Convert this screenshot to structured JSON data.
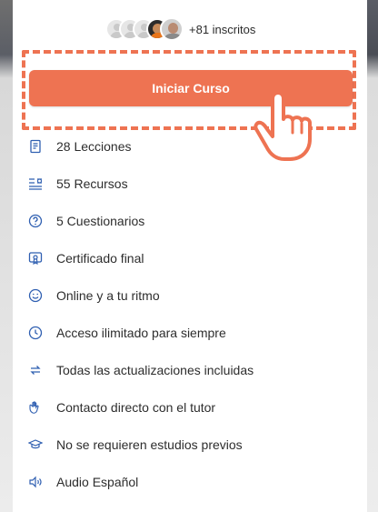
{
  "course_card": {
    "enrolled_text": "+81 inscritos",
    "cta_label": "Iniciar Curso",
    "accent_color": "#ee7352",
    "icon_color": "#2f5fb1"
  },
  "features": [
    {
      "icon": "book-icon",
      "label": "28 Lecciones"
    },
    {
      "icon": "list-icon",
      "label": "55 Recursos"
    },
    {
      "icon": "question-circle-icon",
      "label": "5 Cuestionarios"
    },
    {
      "icon": "certificate-icon",
      "label": "Certificado final"
    },
    {
      "icon": "smile-icon",
      "label": "Online y a tu ritmo"
    },
    {
      "icon": "clock-icon",
      "label": "Acceso ilimitado para siempre"
    },
    {
      "icon": "refresh-icon",
      "label": "Todas las actualizaciones incluidas"
    },
    {
      "icon": "hand-wave-icon",
      "label": "Contacto directo con el tutor"
    },
    {
      "icon": "graduation-cap-icon",
      "label": "No se requieren estudios previos"
    },
    {
      "icon": "speaker-icon",
      "label": "Audio Español"
    }
  ]
}
